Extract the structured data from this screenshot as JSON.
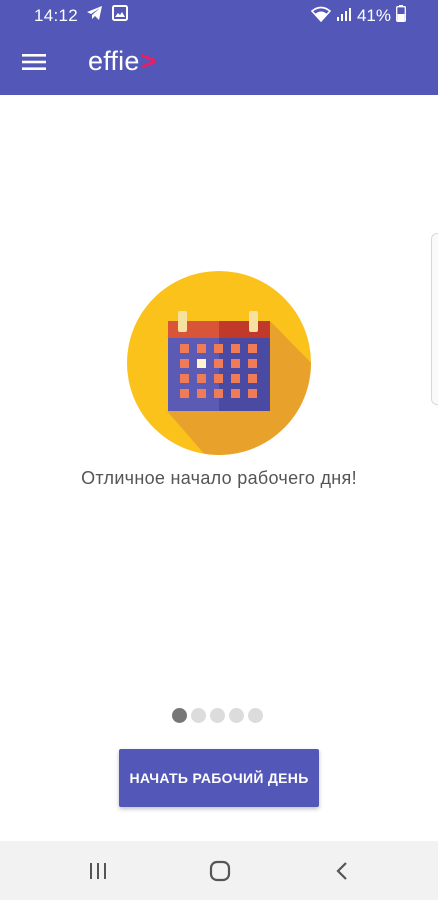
{
  "status_bar": {
    "time": "14:12",
    "battery": "41%",
    "icons": [
      "telegram-icon",
      "image-icon",
      "wifi-icon",
      "signal-icon",
      "battery-icon"
    ]
  },
  "app_bar": {
    "logo": "effie",
    "logo_mark": ">",
    "menu_icon": "hamburger-menu-icon"
  },
  "onboarding": {
    "illustration": "calendar-icon",
    "message": "Отличное начало рабочего дня!",
    "pages": 5,
    "current_page": 1
  },
  "actions": {
    "start_label": "НАЧАТЬ РАБОЧИЙ ДЕНЬ"
  },
  "nav_bar": {
    "icons": [
      "recent-apps-icon",
      "home-icon",
      "back-icon"
    ]
  },
  "colors": {
    "primary": "#5357b8",
    "accent": "#e91e63",
    "circle": "#fbc21b",
    "calendar_header": "#c9422d",
    "calendar_body": "#5b5bb5",
    "calendar_cells": "#f07b57"
  }
}
